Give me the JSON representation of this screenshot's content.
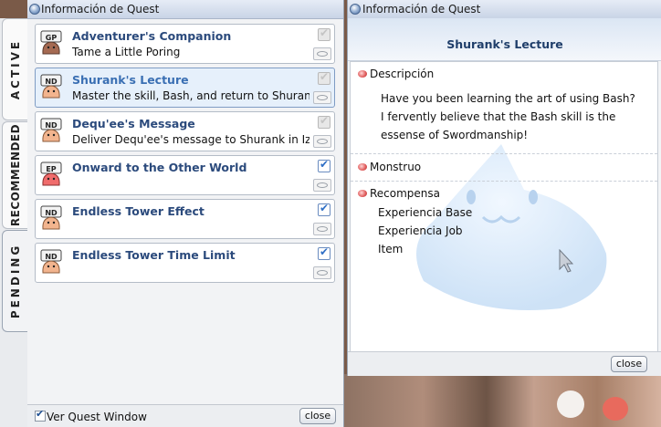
{
  "quest_window": {
    "title": "Información de Quest",
    "tabs": [
      {
        "label": "ACTIVE"
      },
      {
        "label": "RECOMMENDED"
      },
      {
        "label": "PENDING"
      }
    ],
    "quests": [
      {
        "icon": "GP",
        "title": "Adventurer's Companion",
        "description": "Tame a Little Poring",
        "checked": false,
        "selected": false
      },
      {
        "icon": "ND",
        "title": "Shurank's Lecture",
        "description": "Master the skill, Bash, and return to Shurank",
        "checked": false,
        "selected": true
      },
      {
        "icon": "ND",
        "title": "Dequ'ee's Message",
        "description": "Deliver Dequ'ee's message to Shurank in Izl...",
        "checked": false,
        "selected": false
      },
      {
        "icon": "EP",
        "title": "Onward to the Other World",
        "description": "",
        "checked": true,
        "selected": false
      },
      {
        "icon": "ND",
        "title": "Endless Tower Effect",
        "description": "",
        "checked": true,
        "selected": false
      },
      {
        "icon": "ND",
        "title": "Endless Tower Time Limit",
        "description": "",
        "checked": true,
        "selected": false
      }
    ],
    "footer": {
      "checkbox_label": "Ver Quest Window",
      "checkbox_checked": true,
      "close_label": "close"
    }
  },
  "detail_window": {
    "title": "Información de Quest",
    "quest_title": "Shurank's Lecture",
    "description_label": "Descripción",
    "description_text": "Have you been learning the art of using Bash? I fervently believe that the Bash skill is the essense of Swordmanship!",
    "monster_label": "Monstruo",
    "reward_label": "Recompensa",
    "reward_items": [
      "Experiencia Base",
      "Experiencia Job",
      "Item"
    ],
    "close_label": "close"
  },
  "colors": {
    "title_blue": "#2b4a7c",
    "selected_title": "#3a6fb3",
    "check_blue": "#2f6fc6",
    "bullet_red": "#e05a5a"
  }
}
